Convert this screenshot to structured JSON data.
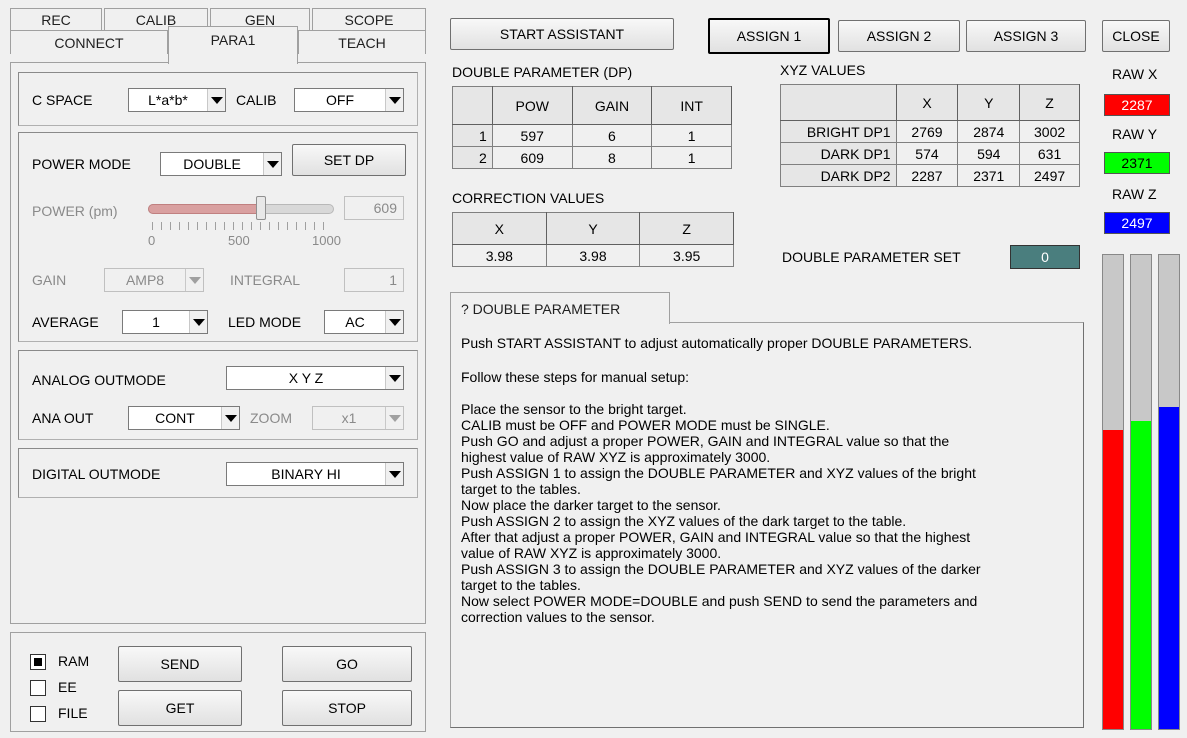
{
  "left_tabs": {
    "row1": [
      "REC",
      "CALIB",
      "GEN",
      "SCOPE"
    ],
    "row2": [
      "CONNECT",
      "PARA1",
      "TEACH"
    ],
    "active": "PARA1"
  },
  "cspace": {
    "label": "C SPACE",
    "value": "L*a*b*"
  },
  "calib": {
    "label": "CALIB",
    "value": "OFF"
  },
  "power_mode": {
    "label": "POWER MODE",
    "value": "DOUBLE",
    "set_dp": "SET DP"
  },
  "power": {
    "label": "POWER (pm)",
    "value": "609",
    "level": 0.609,
    "ticks": [
      "0",
      "500",
      "1000"
    ]
  },
  "gain": {
    "label": "GAIN",
    "value": "AMP8"
  },
  "integral": {
    "label": "INTEGRAL",
    "value": "1"
  },
  "average": {
    "label": "AVERAGE",
    "value": "1"
  },
  "led_mode": {
    "label": "LED MODE",
    "value": "AC"
  },
  "analog_outmode": {
    "label": "ANALOG OUTMODE",
    "value": "X Y Z"
  },
  "ana_out": {
    "label": "ANA OUT",
    "value": "CONT"
  },
  "zoom": {
    "label": "ZOOM",
    "value": "x1"
  },
  "digital_outmode": {
    "label": "DIGITAL OUTMODE",
    "value": "BINARY HI"
  },
  "storage": {
    "ram": "RAM",
    "ee": "EE",
    "file": "FILE",
    "selected": "RAM"
  },
  "buttons": {
    "send": "SEND",
    "get": "GET",
    "go": "GO",
    "stop": "STOP"
  },
  "top_buttons": {
    "start_assistant": "START ASSISTANT",
    "assign1": "ASSIGN 1",
    "assign2": "ASSIGN 2",
    "assign3": "ASSIGN 3",
    "close": "CLOSE"
  },
  "dp_table": {
    "title": "DOUBLE PARAMETER (DP)",
    "headers": [
      "",
      "POW",
      "GAIN",
      "INT"
    ],
    "rows": [
      [
        "1",
        "597",
        "6",
        "1"
      ],
      [
        "2",
        "609",
        "8",
        "1"
      ]
    ]
  },
  "xyz_table": {
    "title": "XYZ VALUES",
    "headers": [
      "",
      "X",
      "Y",
      "Z"
    ],
    "rows": [
      [
        "BRIGHT DP1",
        "2769",
        "2874",
        "3002"
      ],
      [
        "DARK DP1",
        "574",
        "594",
        "631"
      ],
      [
        "DARK DP2",
        "2287",
        "2371",
        "2497"
      ]
    ]
  },
  "correction": {
    "title": "CORRECTION VALUES",
    "headers": [
      "X",
      "Y",
      "Z"
    ],
    "values": [
      "3.98",
      "3.98",
      "3.95"
    ]
  },
  "double_parameter_set": {
    "label": "DOUBLE PARAMETER SET",
    "value": "0"
  },
  "raw": {
    "x": {
      "label": "RAW X",
      "value": "2287",
      "color": "#ff0000"
    },
    "y": {
      "label": "RAW Y",
      "value": "2371",
      "color": "#00ff00"
    },
    "z": {
      "label": "RAW Z",
      "value": "2497",
      "color": "#0000ff"
    }
  },
  "bars": {
    "x_level": 0.63,
    "y_level": 0.65,
    "z_level": 0.68
  },
  "help": {
    "tab": "? DOUBLE PARAMETER",
    "lines": [
      "Push START ASSISTANT to adjust automatically proper DOUBLE PARAMETERS.",
      "",
      "Follow these steps for manual setup:",
      "",
      "Place the sensor to the bright target.",
      "CALIB must be OFF and POWER MODE must be SINGLE.",
      "Push GO and adjust a proper POWER, GAIN and INTEGRAL value so that the",
      "highest value of RAW XYZ is approximately 3000.",
      "Push ASSIGN 1 to assign the DOUBLE PARAMETER and XYZ values of the bright",
      "target to the tables.",
      "Now place the darker target to the sensor.",
      "Push ASSIGN 2 to assign the XYZ values of the dark target to the table.",
      "After that adjust a proper POWER, GAIN and INTEGRAL value so that the highest",
      "value of RAW XYZ is approximately 3000.",
      "Push ASSIGN 3 to assign the DOUBLE PARAMETER and XYZ values of the darker",
      "target to the tables.",
      "Now select POWER MODE=DOUBLE and push SEND to send the parameters and",
      "correction values to the sensor."
    ]
  }
}
